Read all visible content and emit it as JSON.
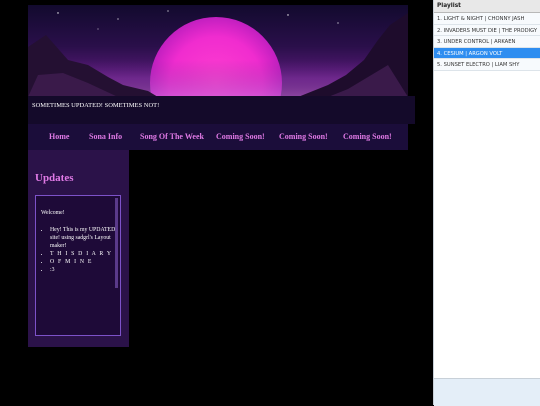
{
  "site": {
    "tagline": "SOMETIMES UPDATED! SOMETIMES NOT!",
    "nav": [
      "Home",
      "Sona Info",
      "Song Of The Week",
      "Coming Soon!",
      "Coming Soon!",
      "Coming Soon!"
    ],
    "updates": {
      "title": "Updates",
      "welcome": "Welcome!",
      "items": [
        "Hey! This is my UPDATED site! using sadgrl's Layout maker!",
        "T H I S D I A R Y",
        "O F M I N E",
        ":3"
      ]
    }
  },
  "playlist": {
    "header": "Playlist",
    "tracks": [
      "1. LIGHT & NIGHT | CHONNY JASH",
      "2. INVADERS MUST DIE | THE PRODIGY",
      "3. UNDER CONTROL | ARKAEN",
      "4. CESIUM | ARGON VOLT",
      "5. SUNSET ELECTRO | LIAM SHY"
    ],
    "active_index": 3
  },
  "colors": {
    "accent_pink": "#e07ae6",
    "panel_purple": "#2b1249",
    "active_track": "#2e8df0"
  }
}
